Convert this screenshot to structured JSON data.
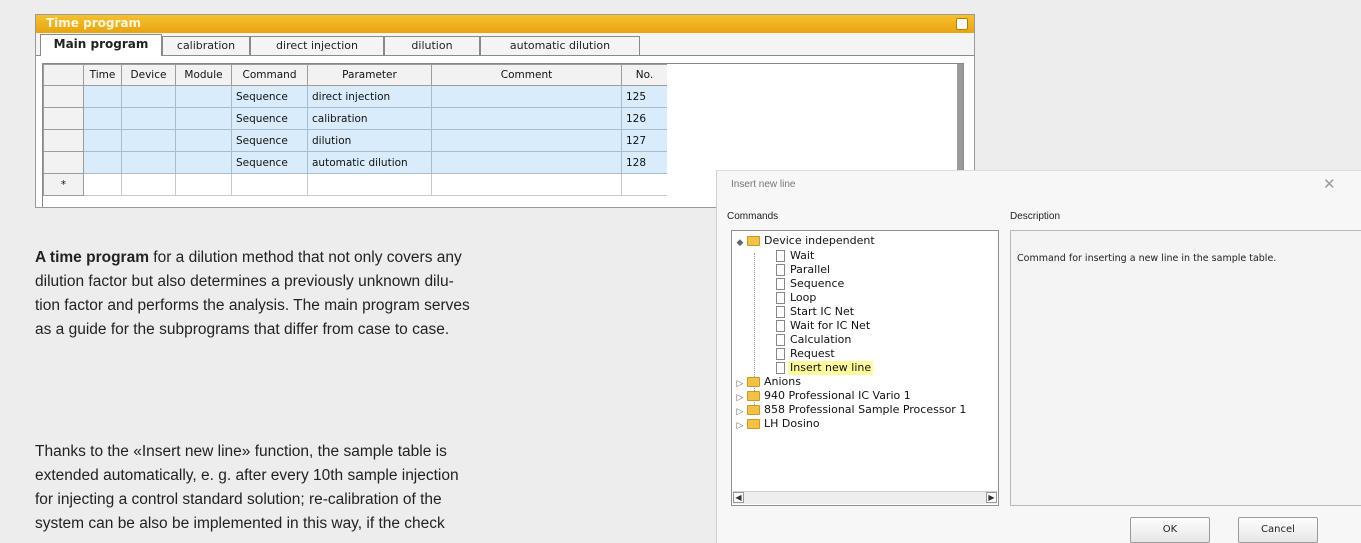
{
  "time_program": {
    "title": "Time program",
    "tabs": [
      "Main program",
      "calibration",
      "direct injection",
      "dilution",
      "automatic dilution"
    ],
    "columns": [
      "Time",
      "Device",
      "Module",
      "Command",
      "Parameter",
      "Comment",
      "No."
    ],
    "rows": [
      {
        "time": "",
        "device": "",
        "module": "",
        "command": "Sequence",
        "parameter": "direct injection",
        "comment": "",
        "no": "125"
      },
      {
        "time": "",
        "device": "",
        "module": "",
        "command": "Sequence",
        "parameter": "calibration",
        "comment": "",
        "no": "126"
      },
      {
        "time": "",
        "device": "",
        "module": "",
        "command": "Sequence",
        "parameter": "dilution",
        "comment": "",
        "no": "127"
      },
      {
        "time": "",
        "device": "",
        "module": "",
        "command": "Sequence",
        "parameter": "automatic dilution",
        "comment": "",
        "no": "128"
      }
    ],
    "new_row_marker": "*"
  },
  "text": {
    "p1_bold": "A time program",
    "p1_line1": " for a dilution method that not only covers any",
    "p1_line2": "dilution factor but also determines a previously unknown dilu-",
    "p1_line3": "tion factor and performs the analysis. The main program serves",
    "p1_line4": "as a guide for the subprograms that differ from case to case.",
    "p2_line1": "Thanks to the «Insert new line» function, the sample table is",
    "p2_line2": "extended automatically, e. g. after every 10th sample injection",
    "p2_line3": "for injecting a control standard solution; re-calibration of the",
    "p2_line4": "system can be also be implemented in this way, if the check"
  },
  "dialog": {
    "title": "Insert new line",
    "close_glyph": "✕",
    "commands_header": "Commands",
    "description_header": "Description",
    "root": "Device independent",
    "items": [
      "Wait",
      "Parallel",
      "Sequence",
      "Loop",
      "Start IC Net",
      "Wait for IC Net",
      "Calculation",
      "Request",
      "Insert new line"
    ],
    "selected_item": "Insert new line",
    "other_groups": [
      "Anions",
      "940 Professional IC Vario 1",
      "858 Professional Sample Processor 1",
      "LH Dosino"
    ],
    "description": "Command for inserting a new line in the sample table.",
    "ok_label": "OK",
    "cancel_label": "Cancel"
  },
  "colors": {
    "titlebar": "#f2b21d",
    "selection": "#d9ecfb",
    "highlight": "#fffa9c"
  }
}
